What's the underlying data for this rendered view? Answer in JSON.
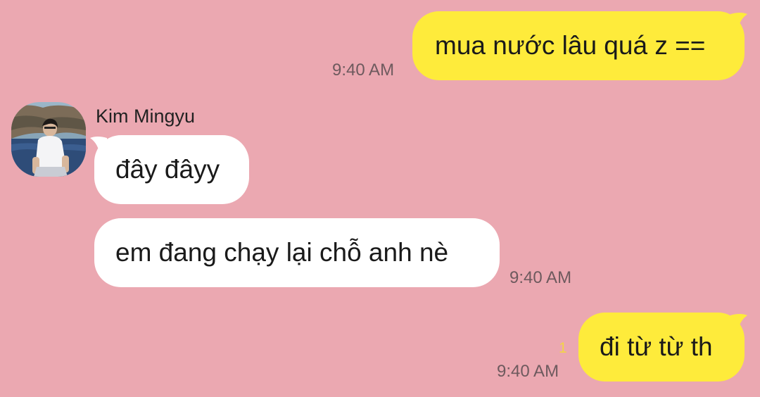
{
  "chat": {
    "messages": [
      {
        "sender": "me",
        "text": "mua nước lâu quá z ==",
        "time": "9:40 AM"
      },
      {
        "sender": "them",
        "name": "Kim Mingyu",
        "text": "đây đâyy"
      },
      {
        "sender": "them",
        "text": "em đang chạy lại chỗ anh nè",
        "time": "9:40 AM"
      },
      {
        "sender": "me",
        "text": "đi từ từ th",
        "time": "9:40 AM",
        "unread_count": "1"
      }
    ]
  },
  "colors": {
    "background": "#EBA8B1",
    "my_bubble": "#FEEB3B",
    "their_bubble": "#FFFFFF",
    "unread": "#F3D447"
  }
}
